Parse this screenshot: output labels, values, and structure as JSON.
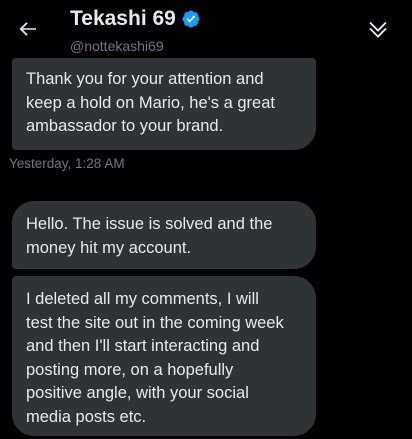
{
  "conversation": {
    "display_name": "Tekashi 69",
    "handle": "@nottekashi69",
    "verified": true,
    "accent_color": "#1d9bf0"
  },
  "icons": {
    "back": "back-arrow-icon",
    "verified": "verified-badge-icon",
    "collapse": "double-chevron-down-icon"
  },
  "messages": [
    {
      "text": "Thank you for your attention and\nkeep a hold on Mario, he's a great\nambassador to your brand."
    },
    {
      "timestamp": "Yesterday, 1:28 AM"
    },
    {
      "text": "Hello. The issue is solved and the\nmoney hit my account."
    },
    {
      "text": "I deleted all my comments, I will\ntest the site out in the coming week\nand then I'll start interacting and\nposting more, on a hopefully\npositive angle, with your social\nmedia posts etc."
    }
  ]
}
